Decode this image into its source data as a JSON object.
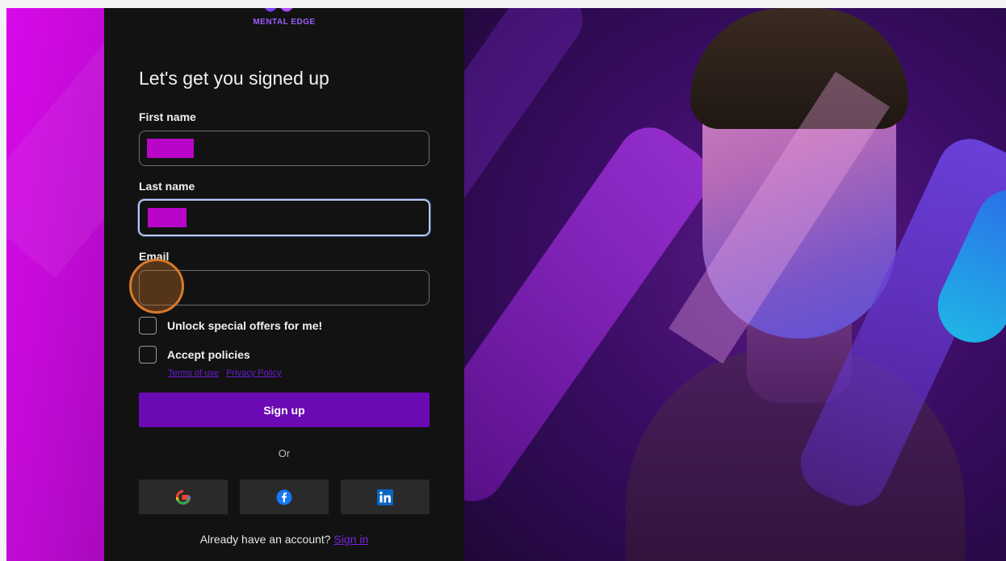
{
  "brand": {
    "logo_text": "MENTAL EDGE"
  },
  "form": {
    "title": "Let's get you signed up",
    "first_name_label": "First name",
    "last_name_label": "Last name",
    "email_label": "Email",
    "email_value": "",
    "offers_label": "Unlock special offers for me!",
    "policies_label": "Accept policies",
    "terms_link": "Terms of use",
    "privacy_link": "Privacy Policy",
    "signup_label": "Sign up",
    "or_text": "Or",
    "have_account_text": "Already have an account?",
    "signin_link": "Sign in"
  },
  "social": [
    "google-icon",
    "facebook-icon",
    "linkedin-icon"
  ],
  "colors": {
    "accent": "#6b09b4",
    "redaction": "#b905c8",
    "link": "#7a22e0"
  }
}
